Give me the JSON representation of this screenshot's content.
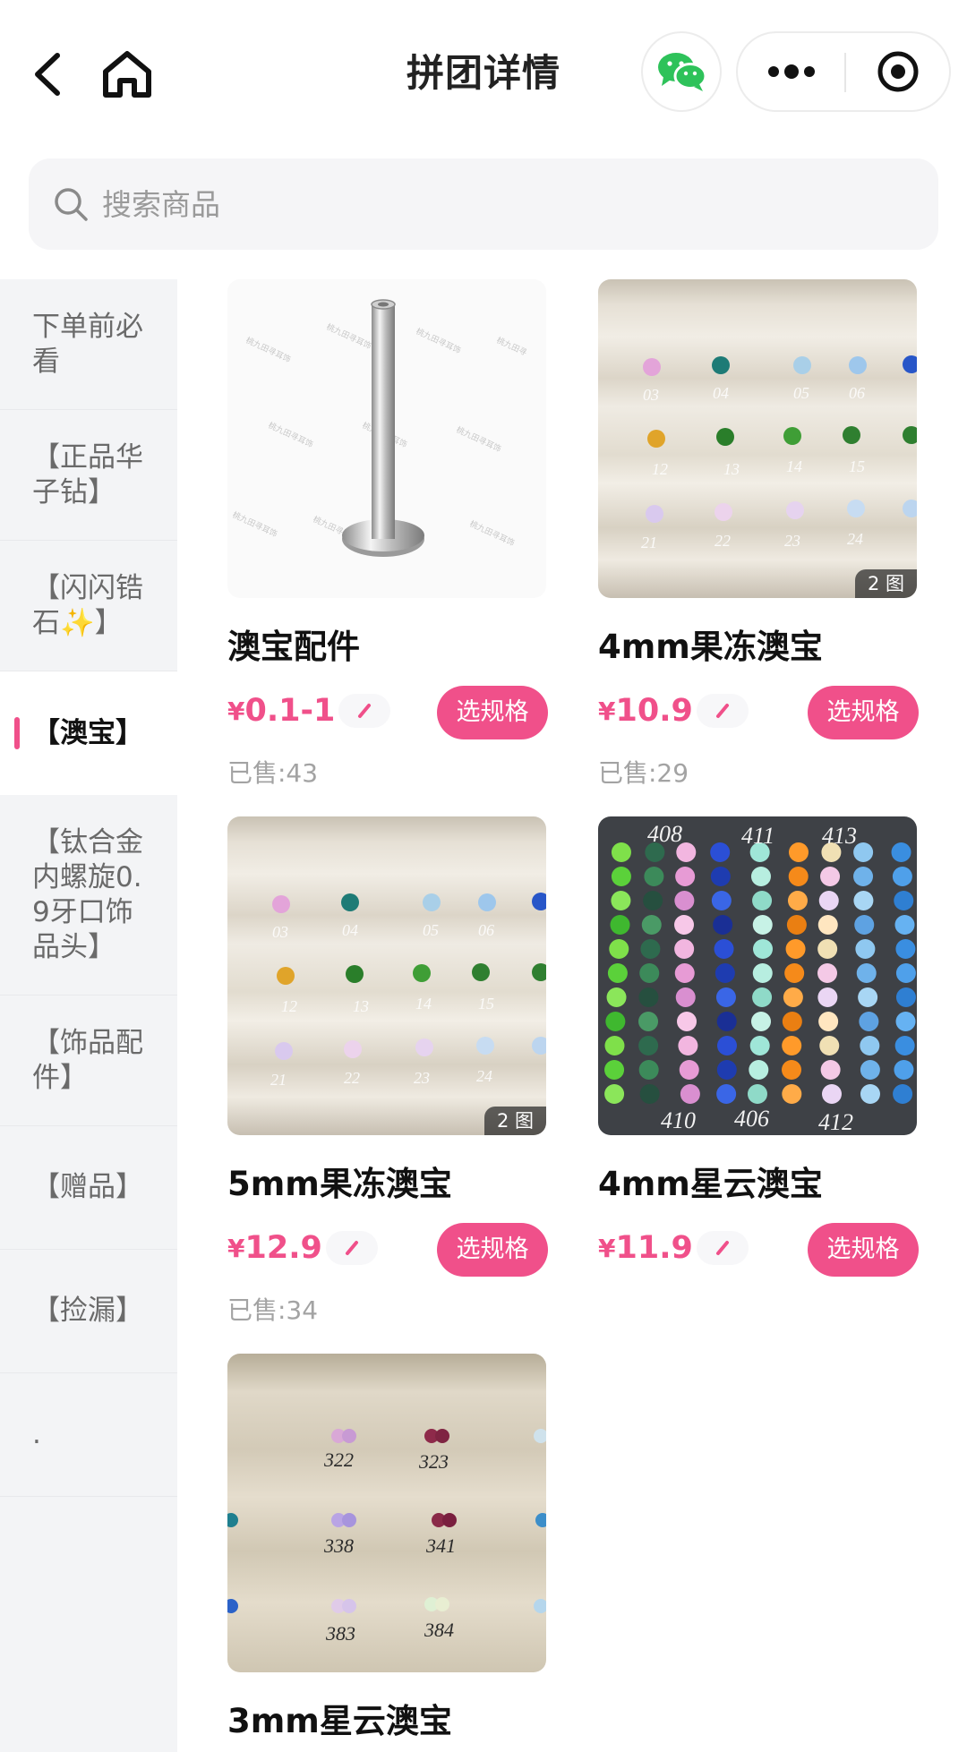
{
  "header": {
    "title": "拼团详情",
    "back_icon": "chevron-left-icon",
    "home_icon": "home-icon",
    "share_icon": "wechat-icon",
    "more_icon": "more-dots-icon",
    "close_icon": "target-circle-icon"
  },
  "search": {
    "placeholder": "搜索商品",
    "icon": "search-icon"
  },
  "sidebar": {
    "active_color": "#f0508a",
    "items": [
      {
        "label": "下单前必看"
      },
      {
        "label": "【正品华子钻】"
      },
      {
        "label": "【闪闪锆石✨】"
      },
      {
        "label": "【澳宝】",
        "active": true
      },
      {
        "label": "【钛合金内螺旋0.9牙口饰品头】"
      },
      {
        "label": "【饰品配件】"
      },
      {
        "label": "【赠品】"
      },
      {
        "label": "【捡漏】"
      },
      {
        "label": "."
      }
    ]
  },
  "products": [
    {
      "name": "澳宝配件",
      "price": "0.1-1",
      "currency": "¥",
      "sold": "已售:43",
      "spec_label": "选规格",
      "image": "silver-labret-post"
    },
    {
      "name": "4mm果冻澳宝",
      "price": "10.9",
      "currency": "¥",
      "sold": "已售:29",
      "spec_label": "选规格",
      "image_count": "2 图",
      "image": "opal-tray",
      "tray_numbers": [
        "03",
        "04",
        "05",
        "06",
        "12",
        "13",
        "14",
        "15",
        "21",
        "22",
        "23",
        "24"
      ]
    },
    {
      "name": "5mm果冻澳宝",
      "price": "12.9",
      "currency": "¥",
      "sold": "已售:34",
      "spec_label": "选规格",
      "image_count": "2 图",
      "image": "opal-tray",
      "tray_numbers": [
        "03",
        "04",
        "05",
        "06",
        "12",
        "13",
        "14",
        "15",
        "21",
        "22",
        "23",
        "24"
      ]
    },
    {
      "name": "4mm星云澳宝",
      "price": "11.9",
      "currency": "¥",
      "spec_label": "选规格",
      "image": "opal-columns",
      "column_numbers_top": [
        "408",
        "411",
        "413"
      ],
      "column_numbers_bottom": [
        "410",
        "406",
        "412"
      ]
    },
    {
      "name": "3mm星云澳宝",
      "image": "opal-velvet",
      "velvet_numbers": [
        "322",
        "323",
        "338",
        "341",
        "383",
        "384"
      ]
    }
  ],
  "colors": {
    "accent": "#f0508a",
    "sidebar_bg": "#f3f4f6",
    "search_bg": "#f5f5f7",
    "wechat_green": "#2ec25a"
  }
}
